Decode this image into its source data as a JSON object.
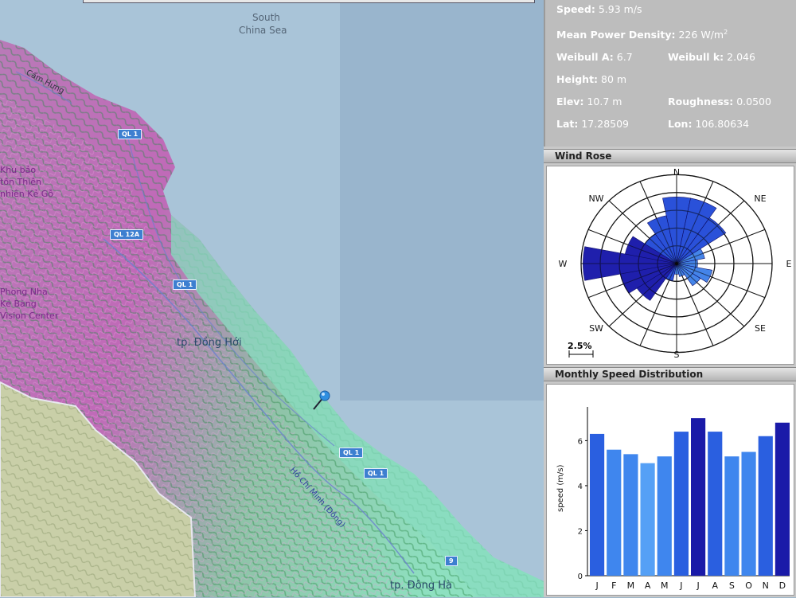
{
  "map": {
    "sea_label_1": "South",
    "sea_label_2": "China Sea",
    "labels": {
      "cam_hung": "Cẩm Hưng",
      "reserve_1": "Khu bảo",
      "reserve_2": "tồn Thiên",
      "reserve_3": "nhiên Kẻ Gỗ",
      "park_1": "Phong Nha",
      "park_2": "Kẻ Bàng",
      "park_3": "Vision Center",
      "dong_hoi": "tp. Đồng Hới",
      "hcm_road": "Hồ Chí Minh (Đông)",
      "dong_ha": "tp. Đông Hà"
    },
    "road_shields": [
      "QL 1",
      "QL 12A",
      "QL 1",
      "QL 1",
      "QL 1",
      "9"
    ],
    "marker": "map-pin-icon"
  },
  "info": {
    "speed_label": "Speed:",
    "speed_value": "5.93 m/s",
    "mpd_label": "Mean Power Density:",
    "mpd_value": "226 W/m",
    "mpd_sup": "2",
    "weibull_a_label": "Weibull A:",
    "weibull_a_value": "6.7",
    "weibull_k_label": "Weibull k:",
    "weibull_k_value": "2.046",
    "height_label": "Height:",
    "height_value": "80 m",
    "elev_label": "Elev:",
    "elev_value": "10.7 m",
    "roughness_label": "Roughness:",
    "roughness_value": "0.0500",
    "lat_label": "Lat:",
    "lat_value": "17.28509",
    "lon_label": "Lon:",
    "lon_value": "106.80634"
  },
  "wind_rose": {
    "header": "Wind Rose",
    "directions": [
      "N",
      "NE",
      "E",
      "SE",
      "S",
      "SW",
      "W",
      "NW"
    ],
    "scale_label": "2.5%",
    "colors": {
      "light": "#3a7ee8",
      "mid": "#1f48d8",
      "dark": "#1414a8"
    }
  },
  "chart_data": {
    "type": "bar",
    "title": "Monthly Speed Distribution",
    "ylabel": "speed (m/s)",
    "categories": [
      "J",
      "F",
      "M",
      "A",
      "M",
      "J",
      "J",
      "A",
      "S",
      "O",
      "N",
      "D"
    ],
    "values": [
      6.3,
      5.6,
      5.4,
      5.0,
      5.3,
      6.4,
      7.0,
      6.4,
      5.3,
      5.5,
      6.2,
      6.8
    ],
    "ylim": [
      0,
      7.5
    ],
    "yticks": [
      "0",
      "2",
      "4",
      "6"
    ],
    "colors": [
      "#2a5fe0",
      "#3f86ee",
      "#3f86ee",
      "#55a0f6",
      "#3f86ee",
      "#2a5fe0",
      "#1a1aa8",
      "#2a5fe0",
      "#3f86ee",
      "#3f86ee",
      "#2a5fe0",
      "#1a1aa8"
    ]
  }
}
